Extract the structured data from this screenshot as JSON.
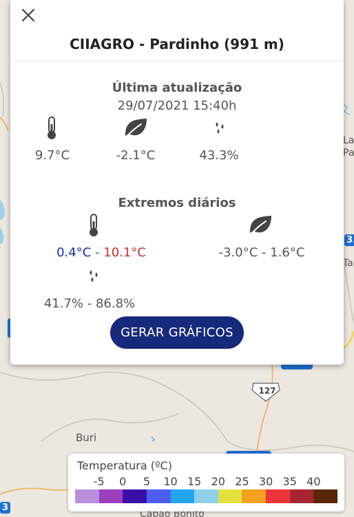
{
  "map": {
    "place_buri": "Buri",
    "place_partial_bottom": "Capão Bonito",
    "place_partial_right_1": "Lar",
    "place_partial_right_2": "Pa",
    "place_partial_right_3": "Ta",
    "road_shield": "127",
    "marker_partial_1": "3.",
    "marker_partial_2": "3"
  },
  "station": {
    "title": "CIIAGRO - Pardinho (991 m)"
  },
  "current": {
    "section_title": "Última atualização",
    "timestamp": "29/07/2021 15:40h",
    "temperature": "9.7°C",
    "dew_point": "-2.1°C",
    "humidity": "43.3%"
  },
  "extremes": {
    "section_title": "Extremos diários",
    "temp_min": "0.4°C",
    "temp_max": "10.1°C",
    "separator": " - ",
    "dew_point_range": "-3.0°C - 1.6°C",
    "humidity_range": "41.7% - 86.8%"
  },
  "actions": {
    "generate_charts": "GERAR GRÁFICOS"
  },
  "legend": {
    "title": "Temperatura (ºC)",
    "ticks": [
      "-5",
      "0",
      "5",
      "10",
      "15",
      "20",
      "25",
      "30",
      "35",
      "40"
    ],
    "colors": [
      "#b98fdc",
      "#9c3fbf",
      "#3a0fa8",
      "#4c5ff0",
      "#22a6f2",
      "#8fd0e8",
      "#e3e23c",
      "#f4a021",
      "#ee3438",
      "#a52532",
      "#5a2608"
    ]
  },
  "colors": {
    "button_bg": "#17297a",
    "min_temp": "#1a2bb0",
    "max_temp": "#d42a2a"
  }
}
